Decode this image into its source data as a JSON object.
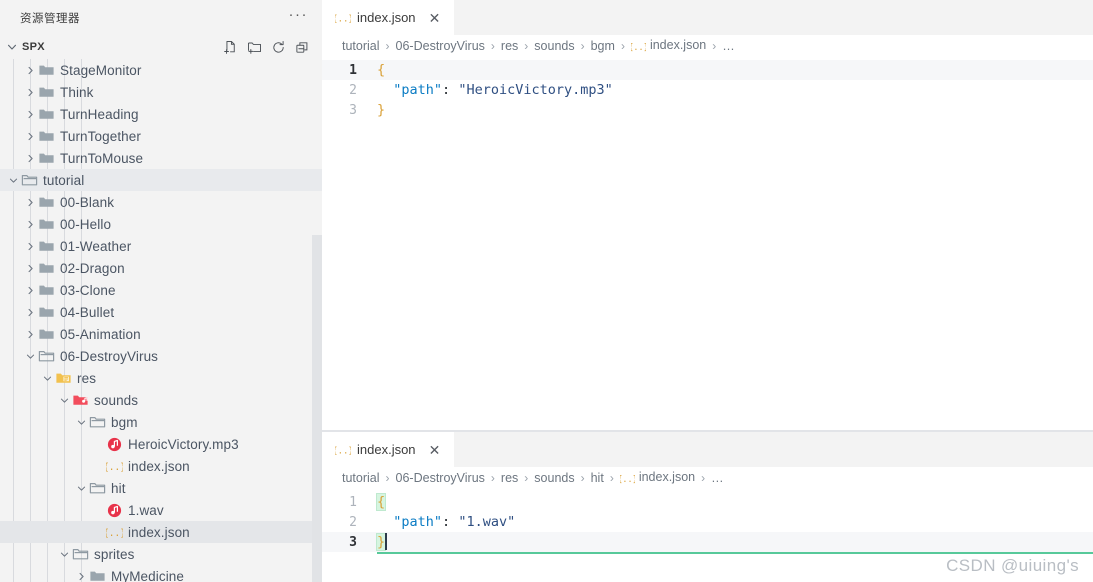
{
  "sidebar": {
    "title": "资源管理器",
    "more_label": "···",
    "section": {
      "label": "SPX",
      "expanded": true,
      "actions": [
        {
          "name": "new-file-icon",
          "tooltip": "新建文件"
        },
        {
          "name": "new-folder-icon",
          "tooltip": "新建文件夹"
        },
        {
          "name": "refresh-icon",
          "tooltip": "刷新资源管理器"
        },
        {
          "name": "collapse-all-icon",
          "tooltip": "在资源管理器中折叠文件夹"
        }
      ]
    },
    "tree": [
      {
        "label": "StageMonitor",
        "depth": 1,
        "type": "folder",
        "state": "collapsed",
        "icon": "folder-icon"
      },
      {
        "label": "Think",
        "depth": 1,
        "type": "folder",
        "state": "collapsed",
        "icon": "folder-icon"
      },
      {
        "label": "TurnHeading",
        "depth": 1,
        "type": "folder",
        "state": "collapsed",
        "icon": "folder-icon"
      },
      {
        "label": "TurnTogether",
        "depth": 1,
        "type": "folder",
        "state": "collapsed",
        "icon": "folder-icon"
      },
      {
        "label": "TurnToMouse",
        "depth": 1,
        "type": "folder",
        "state": "collapsed",
        "icon": "folder-icon"
      },
      {
        "label": "tutorial",
        "depth": 0,
        "type": "folder",
        "state": "expanded",
        "icon": "folder-open-icon",
        "highlight": "focused"
      },
      {
        "label": "00-Blank",
        "depth": 1,
        "type": "folder",
        "state": "collapsed",
        "icon": "folder-icon"
      },
      {
        "label": "00-Hello",
        "depth": 1,
        "type": "folder",
        "state": "collapsed",
        "icon": "folder-icon"
      },
      {
        "label": "01-Weather",
        "depth": 1,
        "type": "folder",
        "state": "collapsed",
        "icon": "folder-icon"
      },
      {
        "label": "02-Dragon",
        "depth": 1,
        "type": "folder",
        "state": "collapsed",
        "icon": "folder-icon"
      },
      {
        "label": "03-Clone",
        "depth": 1,
        "type": "folder",
        "state": "collapsed",
        "icon": "folder-icon"
      },
      {
        "label": "04-Bullet",
        "depth": 1,
        "type": "folder",
        "state": "collapsed",
        "icon": "folder-icon"
      },
      {
        "label": "05-Animation",
        "depth": 1,
        "type": "folder",
        "state": "collapsed",
        "icon": "folder-icon"
      },
      {
        "label": "06-DestroyVirus",
        "depth": 1,
        "type": "folder",
        "state": "expanded",
        "icon": "folder-open-icon"
      },
      {
        "label": "res",
        "depth": 2,
        "type": "folder",
        "state": "expanded",
        "icon": "folder-resource-icon"
      },
      {
        "label": "sounds",
        "depth": 3,
        "type": "folder",
        "state": "expanded",
        "icon": "folder-audio-icon"
      },
      {
        "label": "bgm",
        "depth": 4,
        "type": "folder",
        "state": "expanded",
        "icon": "folder-open-icon"
      },
      {
        "label": "HeroicVictory.mp3",
        "depth": 5,
        "type": "file",
        "state": "none",
        "icon": "audio-file-icon"
      },
      {
        "label": "index.json",
        "depth": 5,
        "type": "file",
        "state": "none",
        "icon": "json-file-icon"
      },
      {
        "label": "hit",
        "depth": 4,
        "type": "folder",
        "state": "expanded",
        "icon": "folder-open-icon"
      },
      {
        "label": "1.wav",
        "depth": 5,
        "type": "file",
        "state": "none",
        "icon": "audio-file-icon"
      },
      {
        "label": "index.json",
        "depth": 5,
        "type": "file",
        "state": "none",
        "icon": "json-file-icon",
        "highlight": "selected"
      },
      {
        "label": "sprites",
        "depth": 3,
        "type": "folder",
        "state": "expanded",
        "icon": "folder-open-icon"
      },
      {
        "label": "MyMedicine",
        "depth": 4,
        "type": "folder",
        "state": "collapsed",
        "icon": "folder-icon"
      }
    ]
  },
  "editors": [
    {
      "name": "top-editor",
      "tab": {
        "label": "index.json",
        "icon": "json-file-icon",
        "close_label": "✕",
        "active": true
      },
      "breadcrumb": [
        "tutorial",
        "06-DestroyVirus",
        "res",
        "sounds",
        "bgm",
        "index.json",
        "…"
      ],
      "breadcrumb_icon_at": 5,
      "active_line": 1,
      "lines": [
        {
          "num": "1",
          "tokens": [
            {
              "t": "{",
              "c": "tok-brace"
            }
          ]
        },
        {
          "num": "2",
          "tokens": [
            {
              "t": "  ",
              "c": "tok-punc"
            },
            {
              "t": "\"path\"",
              "c": "tok-key"
            },
            {
              "t": ": ",
              "c": "tok-punc"
            },
            {
              "t": "\"HeroicVictory.mp3\"",
              "c": "tok-str"
            }
          ]
        },
        {
          "num": "3",
          "tokens": [
            {
              "t": "}",
              "c": "tok-brace"
            }
          ]
        }
      ]
    },
    {
      "name": "bottom-editor",
      "tab": {
        "label": "index.json",
        "icon": "json-file-icon",
        "close_label": "✕",
        "active": true
      },
      "breadcrumb": [
        "tutorial",
        "06-DestroyVirus",
        "res",
        "sounds",
        "hit",
        "index.json",
        "…"
      ],
      "breadcrumb_icon_at": 5,
      "active_line": 3,
      "lines": [
        {
          "num": "1",
          "tokens": [
            {
              "t": "{",
              "c": "tok-brace brace-hl"
            }
          ]
        },
        {
          "num": "2",
          "tokens": [
            {
              "t": "  ",
              "c": "tok-punc"
            },
            {
              "t": "\"path\"",
              "c": "tok-key"
            },
            {
              "t": ": ",
              "c": "tok-punc"
            },
            {
              "t": "\"1.wav\"",
              "c": "tok-str"
            }
          ]
        },
        {
          "num": "3",
          "tokens": [
            {
              "t": "}",
              "c": "tok-brace brace-hl"
            }
          ],
          "caret": true
        }
      ]
    }
  ],
  "watermark": "CSDN @uiuing's",
  "colors": {
    "sidebar_bg": "#f3f3f3",
    "editor_bg": "#ffffff",
    "accent_json": "#d9a036",
    "accent_audio": "#e8334a",
    "tree_text": "#4b5563",
    "selection_bg": "#e4e6e9",
    "bracket_match": "#d6f5e0"
  }
}
